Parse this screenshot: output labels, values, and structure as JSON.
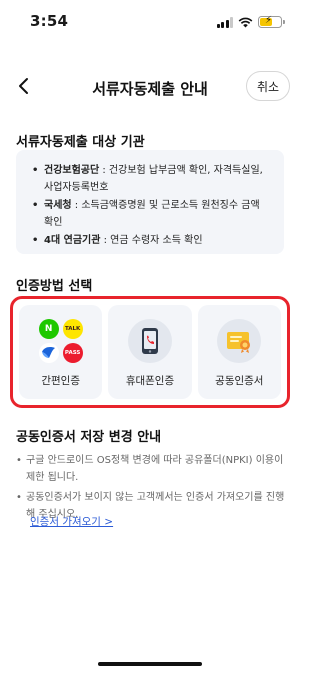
{
  "status_bar": {
    "time": "3:54",
    "battery_level": 0.55,
    "battery_color": "#f5c400"
  },
  "nav": {
    "back_icon": "chevron-left-icon",
    "title": "서류자동제출 안내",
    "cancel_label": "취소"
  },
  "agencies": {
    "title": "서류자동제출 대상 기관",
    "items": [
      {
        "name": "건강보험공단",
        "desc": " : 건강보험 납부금액 확인, 자격득실일, 사업자등록번호"
      },
      {
        "name": "국세청",
        "desc": " : 소득금액증명원 및 근로소득 원천징수 금액 확인"
      },
      {
        "name": "4대 연금기관",
        "desc": " : 연금 수령자 소득 확인"
      }
    ]
  },
  "auth": {
    "title": "인증방법 선택",
    "highlight_color": "#e8242c",
    "methods": [
      {
        "label": "간편인증",
        "icon": "simple-auth-icons",
        "sub_icons": [
          "N",
          "TALK",
          "toss",
          "PASS"
        ]
      },
      {
        "label": "휴대폰인증",
        "icon": "mobile-phone-icon"
      },
      {
        "label": "공동인증서",
        "icon": "certificate-icon"
      }
    ]
  },
  "notice": {
    "title": "공동인증서 저장 변경 안내",
    "items": [
      "구글 안드로이드 OS정책 변경에 따라 공유폴더(NPKI) 이용이 제한 됩니다.",
      "공동인증서가 보이지 않는 고객께서는 인증서 가져오기를 진행해 주십시오."
    ],
    "link_label": "인증서 가져오기 >"
  }
}
